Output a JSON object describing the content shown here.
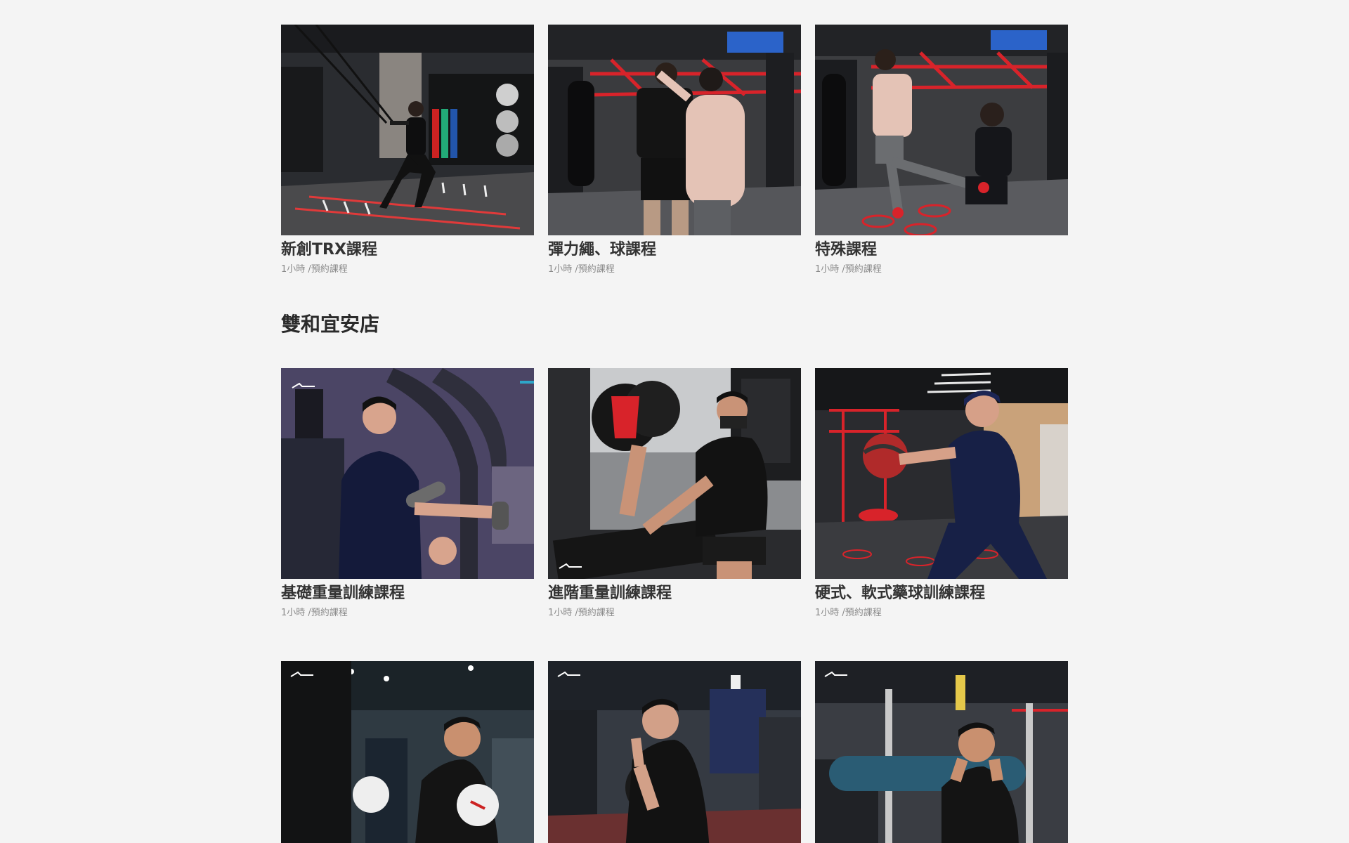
{
  "section_top": {
    "cards": [
      {
        "title": "新創TRX課程",
        "meta": "1小時 /預約課程"
      },
      {
        "title": "彈力繩、球課程",
        "meta": "1小時 /預約課程"
      },
      {
        "title": "特殊課程",
        "meta": "1小時 /預約課程"
      }
    ]
  },
  "store": {
    "heading": "雙和宜安店",
    "cards": [
      {
        "title": "基礎重量訓練課程",
        "meta": "1小時 /預約課程"
      },
      {
        "title": "進階重量訓練課程",
        "meta": "1小時 /預約課程"
      },
      {
        "title": "硬式、軟式藥球訓練課程",
        "meta": "1小時 /預約課程"
      }
    ],
    "more_cards": [
      {
        "photo": "boxing-photo"
      },
      {
        "photo": "kettlebell-photo"
      },
      {
        "photo": "foam-roller-photo"
      }
    ]
  },
  "colors": {
    "background": "#f4f4f4",
    "title": "#333333",
    "meta": "#8a8a8a",
    "gym_red": "#d8232a",
    "gym_dark": "#1f2124"
  }
}
